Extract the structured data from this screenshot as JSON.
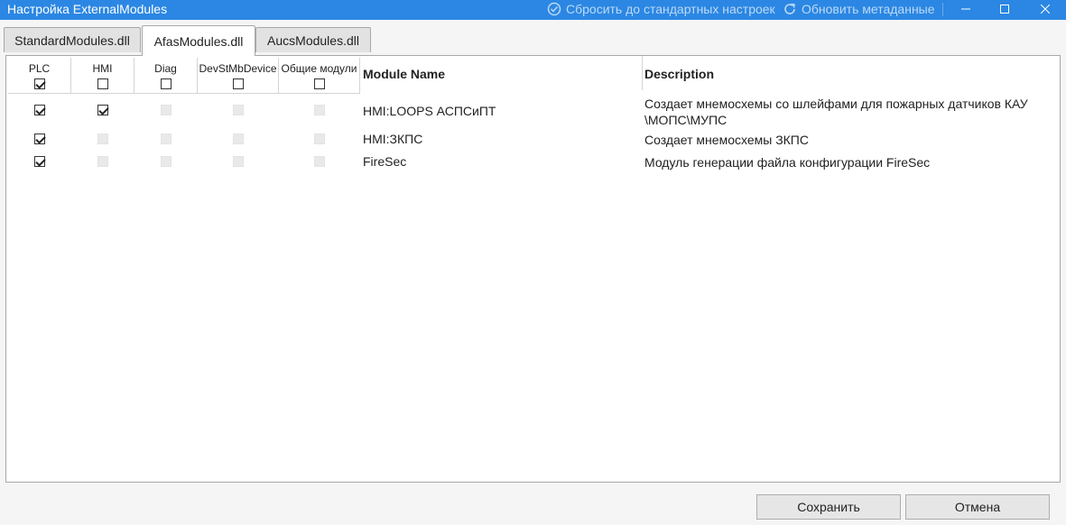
{
  "window": {
    "title": "Настройка ExternalModules",
    "reset_label": "Сбросить до стандартных настроек",
    "refresh_label": "Обновить метаданные",
    "minimize_glyph": "—",
    "maximize_glyph": "☐",
    "close_glyph": "✕"
  },
  "tabs": [
    {
      "label": "StandardModules.dll",
      "active": false
    },
    {
      "label": "AfasModules.dll",
      "active": true
    },
    {
      "label": "AucsModules.dll",
      "active": false
    }
  ],
  "grid": {
    "check_columns": [
      {
        "label": "PLC",
        "checked": true
      },
      {
        "label": "HMI",
        "checked": false
      },
      {
        "label": "Diag",
        "checked": false
      },
      {
        "label": "DevStMbDevice",
        "checked": false
      },
      {
        "label": "Общие модули",
        "checked": false
      }
    ],
    "name_header": "Module Name",
    "description_header": "Description",
    "rows": [
      {
        "name": "HMI:LOOPS АСПСиПТ",
        "description": "Создает мнемосхемы со шлейфами для пожарных датчиков КАУ \\МОПС\\МУПС",
        "checks": [
          true,
          true,
          false,
          false,
          false
        ],
        "enabled": [
          true,
          true,
          false,
          false,
          false
        ]
      },
      {
        "name": "HMI:ЗКПС",
        "description": "Создает мнемосхемы ЗКПС",
        "checks": [
          true,
          false,
          false,
          false,
          false
        ],
        "enabled": [
          true,
          false,
          false,
          false,
          false
        ]
      },
      {
        "name": "FireSec",
        "description": "Модуль генерации файла конфигурации FireSec",
        "checks": [
          true,
          false,
          false,
          false,
          false
        ],
        "enabled": [
          true,
          false,
          false,
          false,
          false
        ]
      }
    ]
  },
  "buttons": {
    "save": "Сохранить",
    "cancel": "Отмена"
  },
  "colors": {
    "titlebar": "#2b87e3",
    "accent": "#2b87e3"
  }
}
